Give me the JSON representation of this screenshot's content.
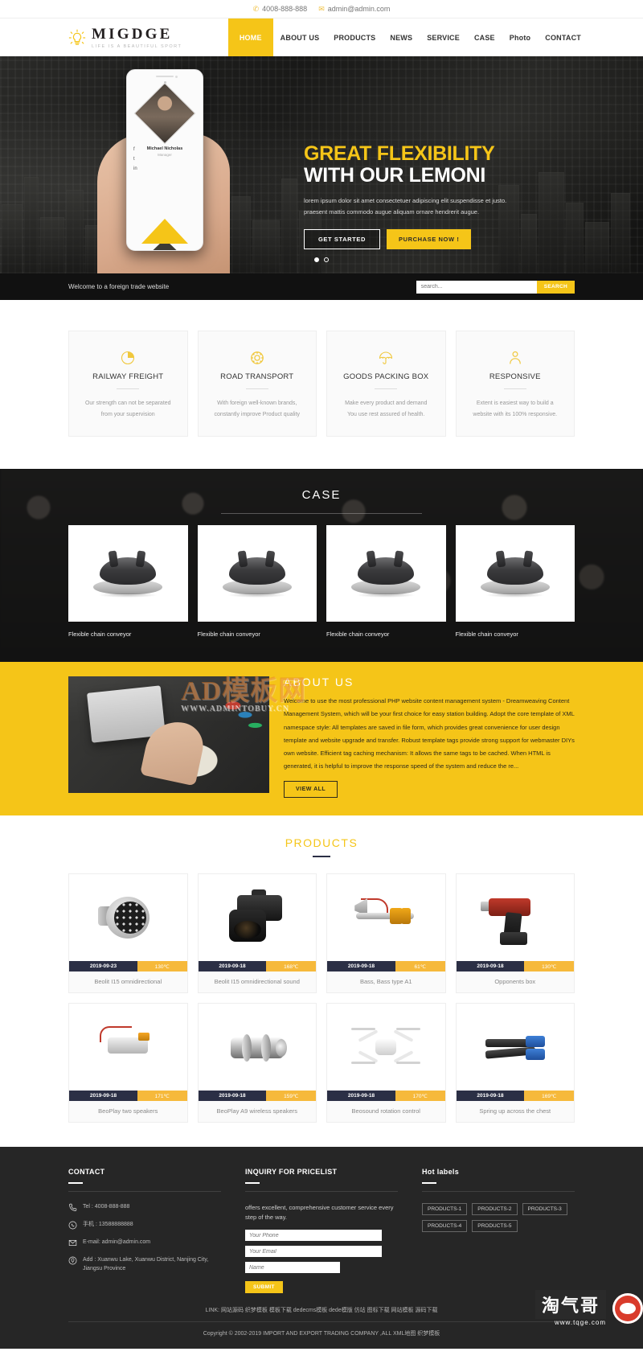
{
  "topbar": {
    "phone": "4008-888-888",
    "email": "admin@admin.com",
    "phone_icon": "phone-icon",
    "email_icon": "envelope-icon"
  },
  "header": {
    "logo_name": "MIGDGE",
    "logo_tagline": "LIFE IS A BEAUTIFUL SPORT",
    "logo_icon": "lightbulb-icon",
    "nav": [
      {
        "label": "HOME",
        "active": true
      },
      {
        "label": "ABOUT US",
        "active": false
      },
      {
        "label": "PRODUCTS",
        "active": false
      },
      {
        "label": "NEWS",
        "active": false
      },
      {
        "label": "SERVICE",
        "active": false
      },
      {
        "label": "CASE",
        "active": false
      },
      {
        "label": "Photo",
        "active": false
      },
      {
        "label": "CONTACT",
        "active": false
      }
    ]
  },
  "hero": {
    "title_line1": "GREAT FLEXIBILITY",
    "title_line2": "WITH OUR LEMONI",
    "paragraph": "lorem ipsum dolor sit amet consectetuer adipiscing elit suspendisse et justo. praesent mattis commodo augue aliquam ornare hendrerit augue.",
    "btn_primary": "GET STARTED",
    "btn_secondary": "PURCHASE NOW !",
    "slide_card_name": "Michael Nicholas",
    "slide_card_role": "Manager",
    "dots": 2,
    "active_dot": 0
  },
  "searchbar": {
    "welcome": "Welcome to a foreign trade website",
    "search_placeholder": "search...",
    "search_button": "SEARCH"
  },
  "features": [
    {
      "icon": "pie-chart-icon",
      "title": "RAILWAY FREIGHT",
      "desc": "Our strength can not be separated from your supervision"
    },
    {
      "icon": "gear-icon",
      "title": "ROAD TRANSPORT",
      "desc": "With foreign well-known brands, constantly improve Product quality"
    },
    {
      "icon": "umbrella-icon",
      "title": "GOODS PACKING BOX",
      "desc": "Make every product and demand You use rest assured of health."
    },
    {
      "icon": "person-icon",
      "title": "RESPONSIVE",
      "desc": "Extent is easiest way to build a website with its 100% responsive."
    }
  ],
  "case": {
    "title": "CASE",
    "items": [
      {
        "caption": "Flexible chain conveyor"
      },
      {
        "caption": "Flexible chain conveyor"
      },
      {
        "caption": "Flexible chain conveyor"
      },
      {
        "caption": "Flexible chain conveyor"
      }
    ]
  },
  "about": {
    "title": "ABOUT US",
    "text": "Welcome to use the most professional PHP website content management system - Dreamweaving Content Management System, which will be your first choice for easy station building. Adopt the core template of XML namespace style: All templates are saved in file form, which provides great convenience for user design template and website upgrade and transfer. Robust template tags provide strong support for webmaster DIYs own website. Efficient tag caching mechanism: It allows the same tags to be cached. When HTML is generated, it is helpful to improve the response speed of the system and reduce the re...",
    "button": "VIEW ALL",
    "watermark_main": "AD模板网",
    "watermark_sub": "WWW.ADMINTOBUY.CN"
  },
  "products": {
    "title": "PRODUCTS",
    "items": [
      {
        "art": "watch",
        "date": "2019-09-23",
        "temp": "130℃",
        "name": "Beolit I15 omnidirectional"
      },
      {
        "art": "camera",
        "date": "2019-09-18",
        "temp": "168℃",
        "name": "Beolit I15 omnidirectional sound"
      },
      {
        "art": "tool",
        "date": "2019-09-18",
        "temp": "61℃",
        "name": "Bass, Bass type A1"
      },
      {
        "art": "gun",
        "date": "2019-09-18",
        "temp": "130℃",
        "name": "Opponents box"
      },
      {
        "art": "connector",
        "date": "2019-09-18",
        "temp": "171℃",
        "name": "BeoPlay two speakers"
      },
      {
        "art": "pipe",
        "date": "2019-09-18",
        "temp": "159℃",
        "name": "BeoPlay A9 wireless speakers"
      },
      {
        "art": "drone",
        "date": "2019-09-18",
        "temp": "170℃",
        "name": "Beosound rotation control"
      },
      {
        "art": "crimp",
        "date": "2019-09-18",
        "temp": "169℃",
        "name": "Spring up across the chest"
      }
    ]
  },
  "footer": {
    "contact": {
      "title": "CONTACT",
      "tel_label": "Tel : 4008-888-888",
      "mobile_label": "手机 : 13588888888",
      "email_label": "E-mail: admin@admin.com",
      "address_label": "Add : Xuanwu Lake, Xuanwu District, Nanjing City, Jiangsu Province"
    },
    "inquiry": {
      "title": "INQUIRY FOR PRICELIST",
      "text": "offers excellent, comprehensive customer service every step of the way.",
      "phone_placeholder": "Your Phone",
      "email_placeholder": "Your Email",
      "name_placeholder": "Name",
      "submit_label": "SUBMIT"
    },
    "hotlabels": {
      "title": "Hot labels",
      "tags": [
        "PRODUCTS-1",
        "PRODUCTS-2",
        "PRODUCTS-3",
        "PRODUCTS-4",
        "PRODUCTS-5"
      ]
    },
    "links": "LINK: 网站源码 织梦模板 模板下载 dedecms模板 dede模版 仿站 图标下载 网站模板 源码下载",
    "copyright": "Copyright © 2002-2019 IMPORT AND EXPORT TRADING COMPANY ,ALL    XML地图    织梦模板",
    "watermark_text": "淘气哥",
    "watermark_sub": "www.tqge.com"
  },
  "colors": {
    "accent": "#f5c518",
    "dark": "#262626",
    "navy": "#2b2f45",
    "orange": "#f6b93b"
  }
}
